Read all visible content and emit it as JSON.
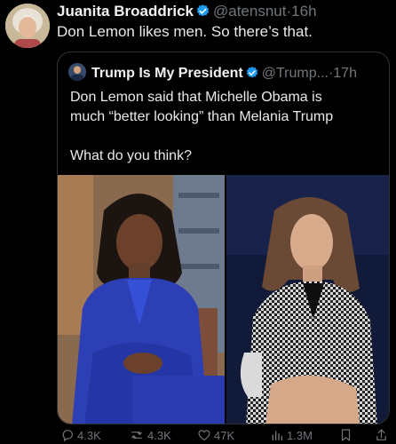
{
  "author": {
    "name": "Juanita Broaddrick",
    "handle": "@atensnut",
    "separator": "·",
    "time": "16h",
    "text": "Don Lemon likes men.  So there’s that."
  },
  "quoted": {
    "name": "Trump Is My President",
    "handle": "@Trump...",
    "separator": "·",
    "time": "17h",
    "line1": "Don Lemon said that Michelle Obama is",
    "line2": "much “better looking” than Melania Trump",
    "line3": "What do you think?"
  },
  "actions": {
    "replies": "4.3K",
    "reposts": "4.3K",
    "likes": "47K",
    "views": "1.3M"
  },
  "icons": {
    "verified": "verified-badge-icon",
    "reply": "reply-icon",
    "repost": "repost-icon",
    "like": "heart-icon",
    "views": "views-icon",
    "bookmark": "bookmark-icon",
    "share": "share-icon"
  },
  "colors": {
    "background": "#000000",
    "verified": "#1d9bf0",
    "muted": "#71767b"
  }
}
